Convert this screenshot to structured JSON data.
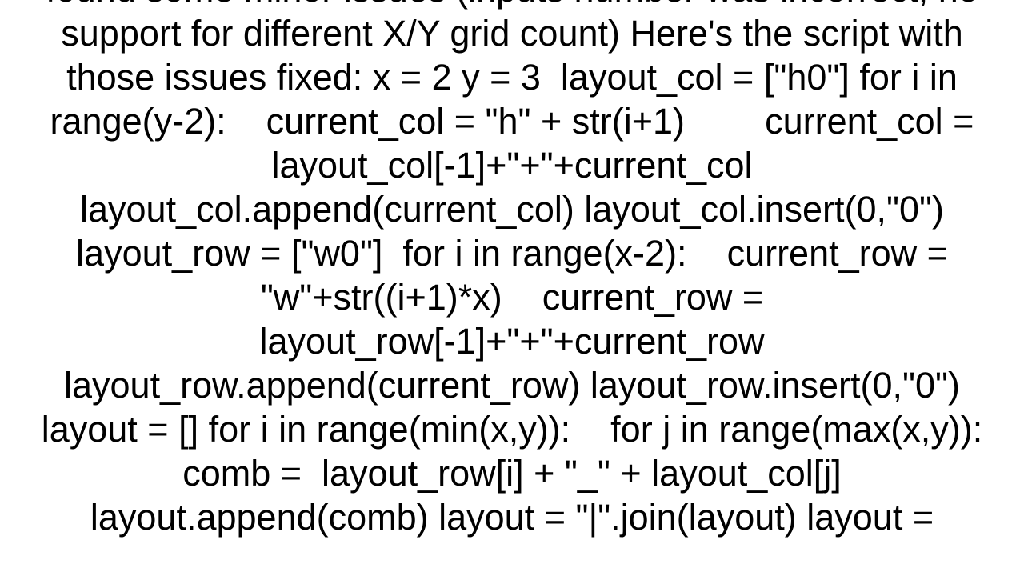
{
  "page": {
    "background_color": "#ffffff",
    "text_color": "#000000",
    "kind": "plain-text-answer-body"
  },
  "body": {
    "full_text": "found some minor issues (inputs number was incorrect, no support for different X/Y grid count) Here's the script with those issues fixed: x = 2 y = 3  layout_col = [\"h0\"] for i in range(y-2):    current_col = \"h\" + str(i+1)        current_col = layout_col[-1]+\"+\"+current_col        layout_col.append(current_col) layout_col.insert(0,\"0\") layout_row = [\"w0\"]  for i in range(x-2):    current_row = \"w\"+str((i+1)*x)    current_row = layout_row[-1]+\"+\"+current_row    layout_row.append(current_row) layout_row.insert(0,\"0\") layout = [] for i in range(min(x,y)):    for j in range(max(x,y)):        comb =  layout_row[i] + \"_\" + layout_col[j]        layout.append(comb) layout = \"|\".join(layout) layout =",
    "lines": [
      "found some minor issues (inputs number was incorrect, no",
      "support for different X/Y grid count) Here's the script with",
      "those issues fixed: x = 2 y = 3  layout_col = [\"h0\"] for i",
      "in range(y-2):    current_col = \"h\" + str(i+1)",
      "current_col = layout_col[-1]+\"+\"+current_col",
      "layout_col.append(current_col) layout_col.insert(0,\"0\")",
      "layout_row = [\"w0\"]  for i in range(x-2):    current_row =",
      "\"w\"+str((i+1)*x)    current_row =",
      "layout_row[-1]+\"+\"+current_row",
      "layout_row.append(current_row) layout_row.insert(0,\"0\")",
      "layout = [] for i in range(min(x,y)):    for j in",
      "range(max(x,y)):        comb =  layout_row[i] + \"_\" +",
      "layout_col[j]        layout.append(comb) layout =",
      "\"|\".join(layout) layout ="
    ],
    "first_line_clipped": true,
    "last_line_clipped": true
  }
}
